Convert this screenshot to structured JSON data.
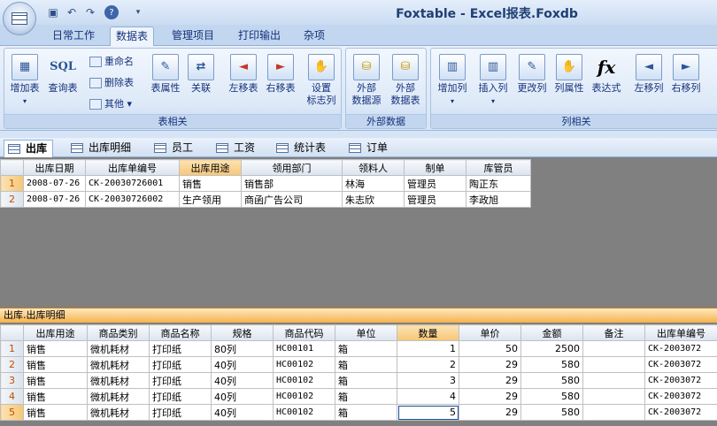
{
  "window": {
    "title": "Foxtable - Excel报表.Foxdb"
  },
  "ribbon_tabs": [
    "日常工作",
    "数据表",
    "管理项目",
    "打印输出",
    "杂项"
  ],
  "active_ribbon_tab": "数据表",
  "groups": {
    "table": {
      "label": "表相关",
      "buttons": {
        "add_table": "增加表",
        "query_table": "查询表",
        "rename": "重命名",
        "delete_table": "删除表",
        "other": "其他",
        "table_props": "表属性",
        "relation": "关联",
        "move_left": "左移表",
        "move_right": "右移表",
        "set_flag_col": "设置",
        "set_flag_col2": "标志列"
      },
      "icons": {
        "sql": "SQL"
      }
    },
    "external": {
      "label": "外部数据",
      "buttons": {
        "ext_source": "外部",
        "ext_source2": "数据源",
        "ext_table": "外部",
        "ext_table2": "数据表"
      }
    },
    "column": {
      "label": "列相关",
      "buttons": {
        "add_col": "增加列",
        "insert_col": "插入列",
        "rename_col": "更改列",
        "col_props": "列属性",
        "expression": "表达式",
        "move_col_left": "左移列",
        "move_col_right": "右移列"
      },
      "icons": {
        "fx": "fx"
      }
    }
  },
  "sheet_tabs": [
    "出库",
    "出库明细",
    "员工",
    "工资",
    "统计表",
    "订单"
  ],
  "active_sheet": "出库",
  "table1": {
    "headers": [
      "出库日期",
      "出库单编号",
      "出库用途",
      "领用部门",
      "领料人",
      "制单",
      "库管员"
    ],
    "rows": [
      {
        "n": "1",
        "cells": [
          "2008-07-26",
          "CK-20030726001",
          "销售",
          "销售部",
          "林海",
          "管理员",
          "陶正东"
        ]
      },
      {
        "n": "2",
        "cells": [
          "2008-07-26",
          "CK-20030726002",
          "生产领用",
          "商函广告公司",
          "朱志欣",
          "管理员",
          "李政旭"
        ]
      }
    ]
  },
  "caption2": "出库.出库明细",
  "table2": {
    "headers": [
      "出库用途",
      "商品类别",
      "商品名称",
      "规格",
      "商品代码",
      "单位",
      "数量",
      "单价",
      "金额",
      "备注",
      "出库单编号"
    ],
    "rows": [
      {
        "n": "1",
        "cells": [
          "销售",
          "微机耗材",
          "打印纸",
          "80列",
          "HC00101",
          "箱",
          "1",
          "50",
          "2500",
          "",
          "CK-2003072"
        ]
      },
      {
        "n": "2",
        "cells": [
          "销售",
          "微机耗材",
          "打印纸",
          "40列",
          "HC00102",
          "箱",
          "2",
          "29",
          "580",
          "",
          "CK-2003072"
        ]
      },
      {
        "n": "3",
        "cells": [
          "销售",
          "微机耗材",
          "打印纸",
          "40列",
          "HC00102",
          "箱",
          "3",
          "29",
          "580",
          "",
          "CK-2003072"
        ]
      },
      {
        "n": "4",
        "cells": [
          "销售",
          "微机耗材",
          "打印纸",
          "40列",
          "HC00102",
          "箱",
          "4",
          "29",
          "580",
          "",
          "CK-2003072"
        ]
      },
      {
        "n": "5",
        "cells": [
          "销售",
          "微机耗材",
          "打印纸",
          "40列",
          "HC00102",
          "箱",
          "5",
          "29",
          "580",
          "",
          "CK-2003072"
        ]
      }
    ]
  }
}
